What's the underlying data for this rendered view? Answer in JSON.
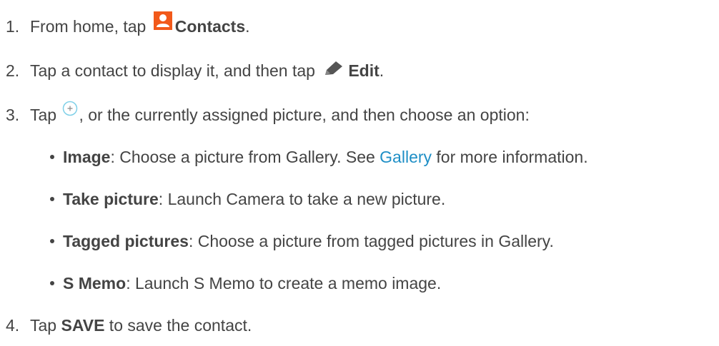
{
  "steps": [
    {
      "number": "1.",
      "text_before": "From home, tap ",
      "icon": "contacts-icon",
      "bold": "Contacts",
      "text_after": "."
    },
    {
      "number": "2.",
      "text_before": "Tap a contact to display it, and then tap ",
      "icon": "edit-pencil-icon",
      "bold": "Edit",
      "text_after": "."
    },
    {
      "number": "3.",
      "text_before": "Tap ",
      "icon": "add-plus-icon",
      "text_after": ", or the currently assigned picture, and then choose an option:"
    },
    {
      "number": "4.",
      "text_before": "Tap ",
      "bold": "SAVE",
      "text_after": " to save the contact."
    }
  ],
  "options": [
    {
      "bold": "Image",
      "text_before_link": ": Choose a picture from Gallery. See ",
      "link": "Gallery",
      "text_after_link": " for more information."
    },
    {
      "bold": "Take picture",
      "text": ": Launch Camera to take a new picture."
    },
    {
      "bold": "Tagged pictures",
      "text": ": Choose a picture from tagged pictures in Gallery."
    },
    {
      "bold": "S Memo",
      "text": ": Launch S Memo to create a memo image."
    }
  ],
  "colors": {
    "text": "#444444",
    "link": "#1f8fc6",
    "contacts_icon_bg": "#f2591a",
    "add_icon_ring": "#7fd0e8"
  }
}
